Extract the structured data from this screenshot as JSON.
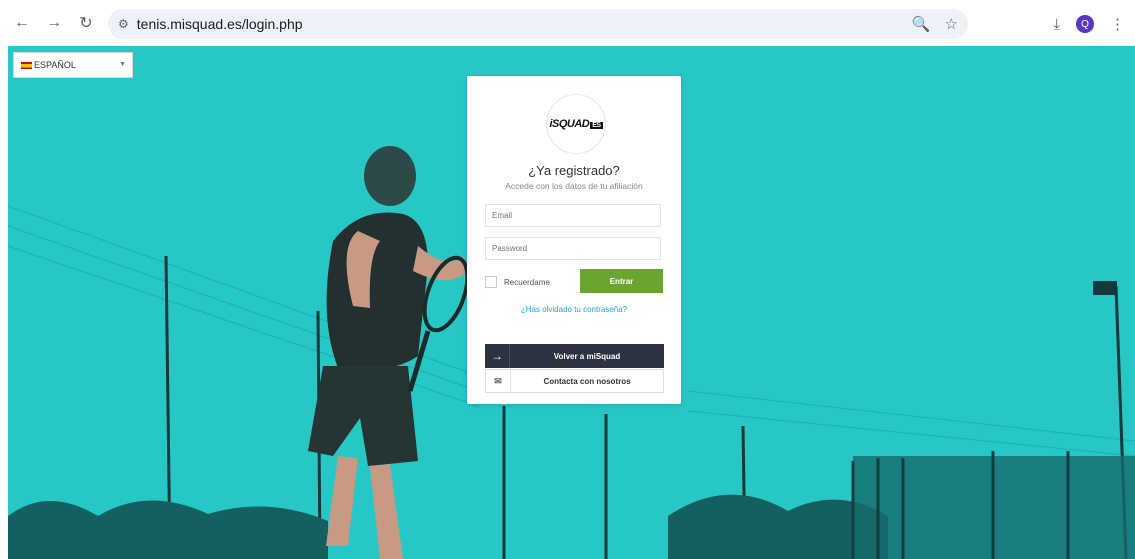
{
  "browser": {
    "url": "tenis.misquad.es/login.php",
    "profile_initial": "Q"
  },
  "language": {
    "selected": "ESPAÑOL"
  },
  "login": {
    "logo_text": "iSQUAD",
    "logo_badge": "ES",
    "title": "¿Ya registrado?",
    "subtitle": "Accede con los datos de tu afiliación",
    "email_placeholder": "Email",
    "password_placeholder": "Password",
    "remember_label": "Recuerdame",
    "submit_label": "Entrar",
    "forgot_label": "¿Has olvidado tu contraseña?",
    "back_label": "Volver a miSquad",
    "contact_label": "Contacta con nosotros"
  },
  "colors": {
    "background": "#27c7c6",
    "submit": "#6aa532",
    "dark_button": "#2d3240",
    "link": "#2a9fd6"
  }
}
